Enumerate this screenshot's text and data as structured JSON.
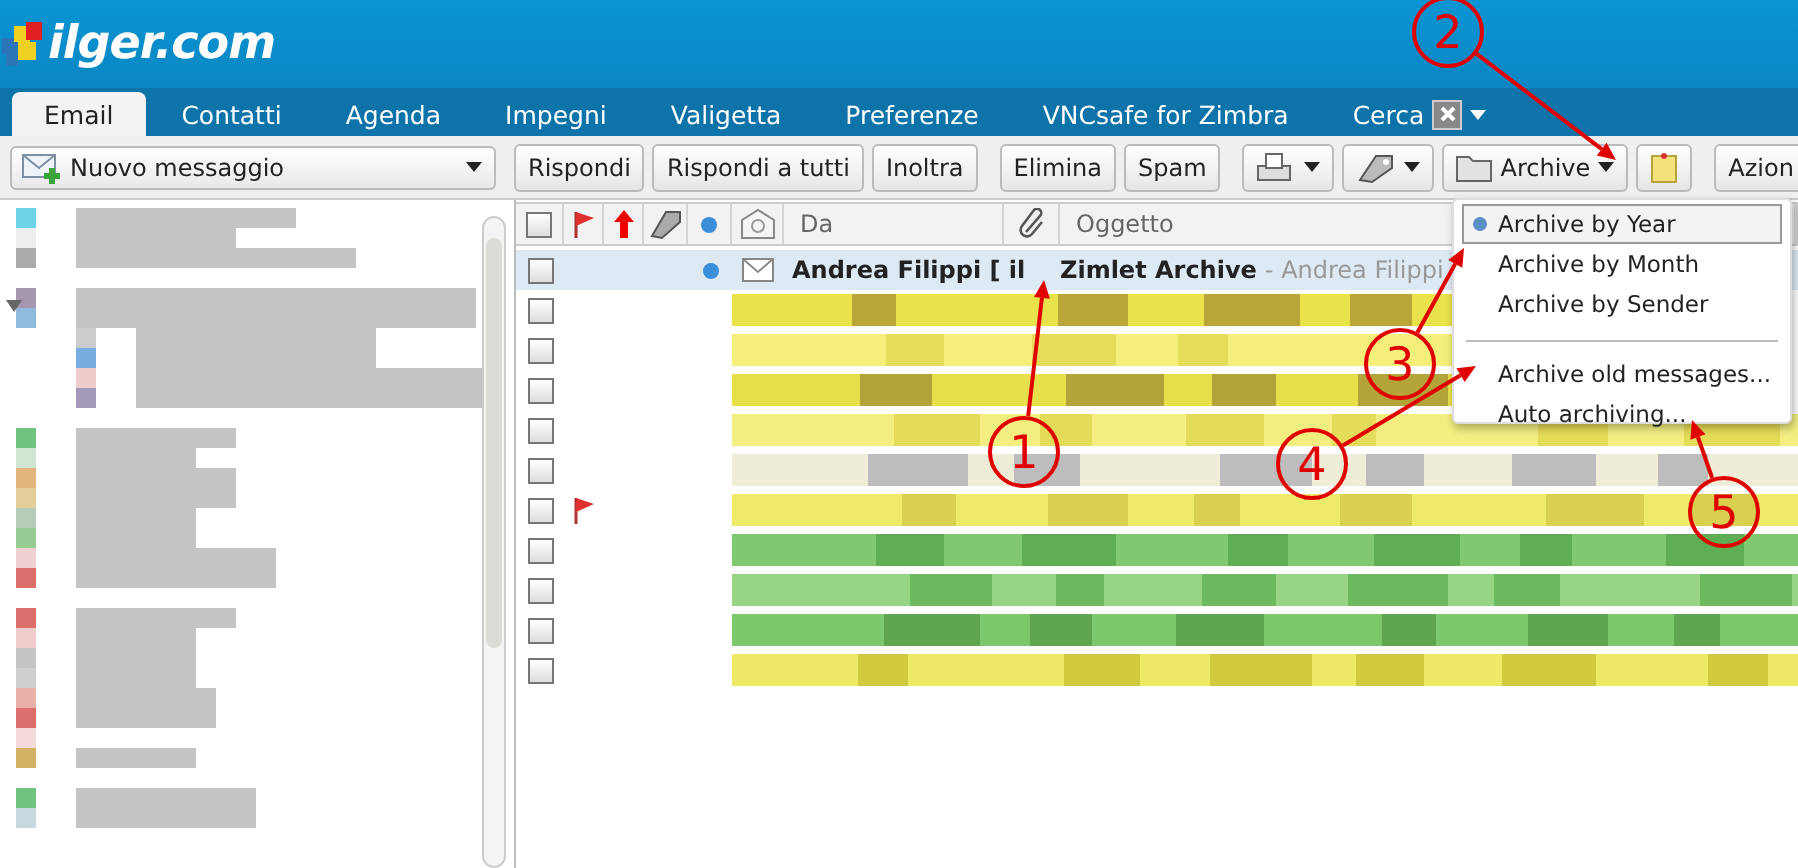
{
  "header": {
    "logo": "ilger.com"
  },
  "tabs": [
    {
      "label": "Email",
      "selected": true
    },
    {
      "label": "Contatti",
      "selected": false
    },
    {
      "label": "Agenda",
      "selected": false
    },
    {
      "label": "Impegni",
      "selected": false
    },
    {
      "label": "Valigetta",
      "selected": false
    },
    {
      "label": "Preferenze",
      "selected": false
    },
    {
      "label": "VNCsafe for Zimbra",
      "selected": false
    },
    {
      "label": "Cerca",
      "selected": false,
      "kind": "search"
    }
  ],
  "toolbar": {
    "new_message": "Nuovo messaggio",
    "buttons": [
      {
        "kind": "text",
        "label": "Rispondi"
      },
      {
        "kind": "text",
        "label": "Rispondi a tutti"
      },
      {
        "kind": "text",
        "label": "Inoltra"
      },
      {
        "kind": "text",
        "label": "Elimina"
      },
      {
        "kind": "text",
        "label": "Spam"
      },
      {
        "kind": "print"
      },
      {
        "kind": "tag"
      },
      {
        "kind": "archive",
        "label": "Archive"
      },
      {
        "kind": "note"
      },
      {
        "kind": "text",
        "label": "Azion"
      }
    ]
  },
  "message_list": {
    "columns": [
      {
        "kind": "check",
        "checked": false
      },
      {
        "kind": "flag"
      },
      {
        "kind": "priority"
      },
      {
        "kind": "tag"
      },
      {
        "kind": "status"
      },
      {
        "kind": "read"
      },
      {
        "kind": "text",
        "label": "Da"
      },
      {
        "kind": "attach"
      },
      {
        "kind": "text",
        "label": "Oggetto"
      }
    ],
    "rows": [
      {
        "kind": "message",
        "from": "Andrea Filippi [ il",
        "subject": "Zimlet Archive",
        "fragment": "- Andrea Filippi",
        "selected": true,
        "checked": false,
        "flagged": false,
        "unread": true
      },
      {
        "kind": "redacted",
        "selected": false,
        "checked": false,
        "flagged": false
      },
      {
        "kind": "redacted",
        "selected": false,
        "checked": false,
        "flagged": false
      },
      {
        "kind": "redacted",
        "selected": false,
        "checked": false,
        "flagged": false
      },
      {
        "kind": "redacted",
        "selected": false,
        "checked": false,
        "flagged": false
      },
      {
        "kind": "redacted",
        "selected": false,
        "checked": false,
        "flagged": false
      },
      {
        "kind": "redacted",
        "selected": false,
        "checked": false,
        "flagged": true
      },
      {
        "kind": "redacted",
        "selected": false,
        "checked": false,
        "flagged": false
      },
      {
        "kind": "redacted",
        "selected": false,
        "checked": false,
        "flagged": false
      },
      {
        "kind": "redacted",
        "selected": false,
        "checked": false,
        "flagged": false
      },
      {
        "kind": "redacted",
        "selected": false,
        "checked": false,
        "flagged": false
      }
    ]
  },
  "archive_menu": {
    "items": [
      {
        "kind": "radio",
        "label": "Archive by Year",
        "selected": true
      },
      {
        "kind": "radio",
        "label": "Archive by Month",
        "selected": false
      },
      {
        "kind": "radio",
        "label": "Archive by Sender",
        "selected": false
      },
      {
        "kind": "separator"
      },
      {
        "kind": "action",
        "label": "Archive old messages..."
      },
      {
        "kind": "action",
        "label": "Auto archiving..."
      }
    ]
  },
  "annotations": [
    {
      "label": "1"
    },
    {
      "label": "2"
    },
    {
      "label": "3"
    },
    {
      "label": "4"
    },
    {
      "label": "5"
    }
  ]
}
